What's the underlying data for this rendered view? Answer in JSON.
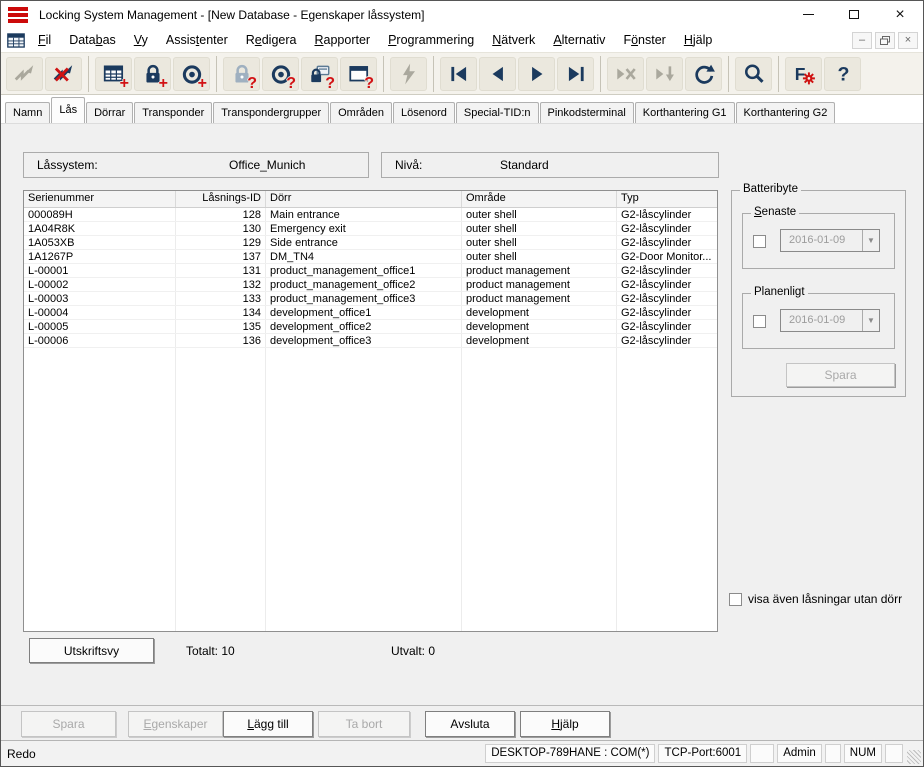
{
  "window": {
    "title": "Locking System Management - [New Database - Egenskaper låssystem]"
  },
  "menu": {
    "items": [
      {
        "label": "Fil",
        "mnemonic": 0
      },
      {
        "label": "Databas",
        "mnemonic": 4
      },
      {
        "label": "Vy",
        "mnemonic": 0
      },
      {
        "label": "Assistenter",
        "mnemonic": 5
      },
      {
        "label": "Redigera",
        "mnemonic": 1
      },
      {
        "label": "Rapporter",
        "mnemonic": 0
      },
      {
        "label": "Programmering",
        "mnemonic": 0
      },
      {
        "label": "Nätverk",
        "mnemonic": 0
      },
      {
        "label": "Alternativ",
        "mnemonic": 0
      },
      {
        "label": "Fönster",
        "mnemonic": 1
      },
      {
        "label": "Hjälp",
        "mnemonic": 0
      }
    ]
  },
  "toolbar": {
    "group_sizes": [
      2,
      3,
      4,
      1,
      4,
      3,
      1,
      2
    ],
    "buttons": [
      {
        "icon": "connect-icon",
        "enabled": false
      },
      {
        "icon": "disconnect-icon",
        "enabled": true
      },
      {
        "icon": "new-locking-system-icon",
        "enabled": true,
        "badge": "+"
      },
      {
        "icon": "new-lock-icon",
        "enabled": true,
        "badge": "+"
      },
      {
        "icon": "new-transponder-icon",
        "enabled": true,
        "badge": "+"
      },
      {
        "icon": "read-lock-icon",
        "enabled": true,
        "badge": "?"
      },
      {
        "icon": "read-transponder-icon",
        "enabled": true,
        "badge": "?"
      },
      {
        "icon": "read-g1-lock-icon",
        "enabled": true,
        "badge": "?"
      },
      {
        "icon": "read-window-icon",
        "enabled": true,
        "badge": "?"
      },
      {
        "icon": "flash-icon",
        "enabled": false
      },
      {
        "icon": "first-record-icon",
        "enabled": true
      },
      {
        "icon": "previous-record-icon",
        "enabled": true
      },
      {
        "icon": "next-record-icon",
        "enabled": true
      },
      {
        "icon": "last-record-icon",
        "enabled": true
      },
      {
        "icon": "cancel-navigation-icon",
        "enabled": false
      },
      {
        "icon": "skip-down-icon",
        "enabled": false
      },
      {
        "icon": "refresh-icon",
        "enabled": true
      },
      {
        "icon": "search-icon",
        "enabled": true
      },
      {
        "icon": "filter-settings-icon",
        "enabled": true
      },
      {
        "icon": "help-icon",
        "enabled": true
      }
    ]
  },
  "tabs": {
    "active_index": 1,
    "items": [
      "Namn",
      "Lås",
      "Dörrar",
      "Transponder",
      "Transpondergrupper",
      "Områden",
      "Lösenord",
      "Special-TID:n",
      "Pinkodsterminal",
      "Korthantering G1",
      "Korthantering G2"
    ]
  },
  "fields": {
    "locking_system_label": "Låssystem:",
    "locking_system_value": "Office_Munich",
    "level_label": "Nivå:",
    "level_value": "Standard"
  },
  "table": {
    "columns": [
      "Serienummer",
      "Låsnings-ID",
      "Dörr",
      "Område",
      "Typ"
    ],
    "rows": [
      [
        "000089H",
        "128",
        "Main entrance",
        "outer shell",
        "G2-låscylinder"
      ],
      [
        "1A04R8K",
        "130",
        "Emergency exit",
        "outer shell",
        "G2-låscylinder"
      ],
      [
        "1A053XB",
        "129",
        "Side entrance",
        "outer shell",
        "G2-låscylinder"
      ],
      [
        "1A1267P",
        "137",
        "DM_TN4",
        "outer shell",
        "G2-Door Monitor..."
      ],
      [
        "L-00001",
        "131",
        "product_management_office1",
        "product management",
        "G2-låscylinder"
      ],
      [
        "L-00002",
        "132",
        "product_management_office2",
        "product management",
        "G2-låscylinder"
      ],
      [
        "L-00003",
        "133",
        "product_management_office3",
        "product management",
        "G2-låscylinder"
      ],
      [
        "L-00004",
        "134",
        "development_office1",
        "development",
        "G2-låscylinder"
      ],
      [
        "L-00005",
        "135",
        "development_office2",
        "development",
        "G2-låscylinder"
      ],
      [
        "L-00006",
        "136",
        "development_office3",
        "development",
        "G2-låscylinder"
      ]
    ]
  },
  "battery": {
    "title": "Batteribyte",
    "latest": {
      "label": "Senaste",
      "mnemonic": 0,
      "date": "2016-01-09",
      "checked": false
    },
    "scheduled": {
      "label": "Planenligt",
      "date": "2016-01-09",
      "checked": false
    },
    "save_label": "Spara"
  },
  "options": {
    "show_without_door_label": "visa även låsningar utan dörr",
    "checked": false
  },
  "summary": {
    "print_button": "Utskriftsvy",
    "total_label": "Totalt: 10",
    "selected_label": "Utvalt: 0"
  },
  "actions": [
    {
      "label": "Spara",
      "enabled": false,
      "mnemonic": -1
    },
    {
      "label": "Egenskaper",
      "enabled": false,
      "mnemonic": 0
    },
    {
      "label": "Lägg till",
      "enabled": true,
      "mnemonic": 0
    },
    {
      "label": "Ta bort",
      "enabled": false,
      "mnemonic": -1
    },
    {
      "label": "Avsluta",
      "enabled": true,
      "mnemonic": -1
    },
    {
      "label": "Hjälp",
      "enabled": true,
      "mnemonic": 0
    }
  ],
  "statusbar": {
    "status": "Redo",
    "panels": [
      "DESKTOP-789HANE : COM(*)",
      "TCP-Port:6001",
      "",
      "Admin",
      "",
      "NUM",
      ""
    ]
  },
  "colors": {
    "accent_navy": "#1b3a5e",
    "accent_red": "#cf1313",
    "disabled_gray": "#aaa89d",
    "toolbar_bg": "#f4f2ec",
    "content_bg": "#f0f0f0",
    "logo_red": "#cc0a0a"
  }
}
